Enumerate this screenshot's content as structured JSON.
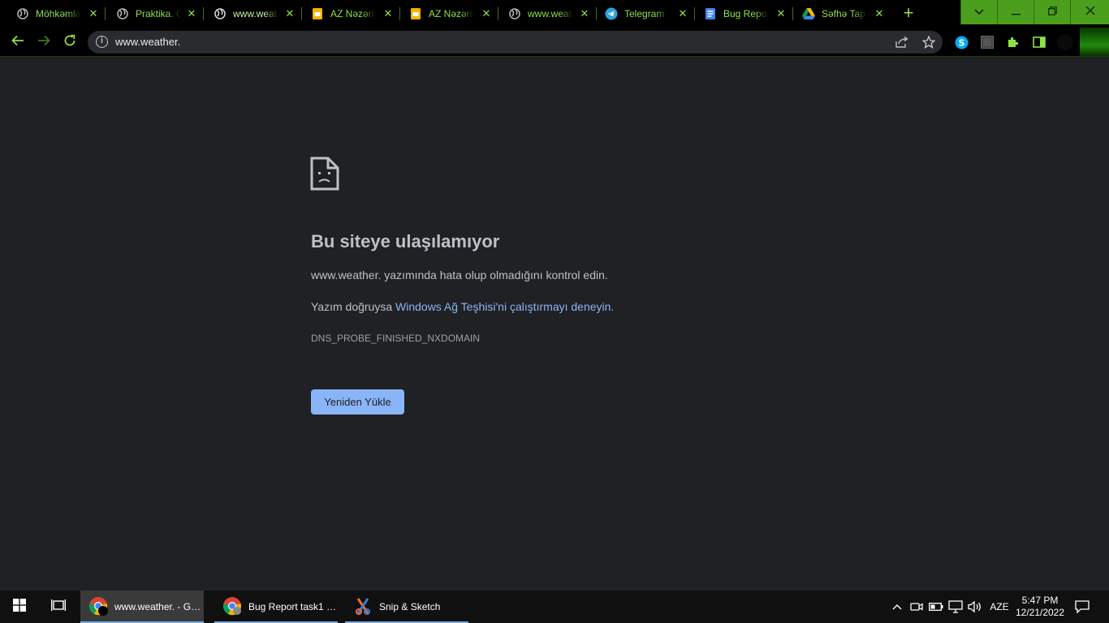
{
  "tabs": [
    {
      "title": "Möhkəmlə",
      "icon": "globe-icon"
    },
    {
      "title": "Praktika. C",
      "icon": "globe-icon"
    },
    {
      "title": "www.weat",
      "icon": "globe-icon",
      "active": true
    },
    {
      "title": "AZ Nəzəriy",
      "icon": "slides-icon"
    },
    {
      "title": "AZ Nəzəriy",
      "icon": "slides-icon"
    },
    {
      "title": "www.weat",
      "icon": "globe-icon"
    },
    {
      "title": "Telegram",
      "icon": "telegram-icon"
    },
    {
      "title": "Bug Repor",
      "icon": "docs-icon"
    },
    {
      "title": "Səfhə Tapı",
      "icon": "drive-icon"
    }
  ],
  "omnibox": {
    "url": "www.weather."
  },
  "error_page": {
    "heading": "Bu siteye ulaşılamıyor",
    "line1": "www.weather. yazımında hata olup olmadığını kontrol edin.",
    "line2_prefix": "Yazım doğruysa ",
    "line2_link": "Windows Ağ Teşhisi'ni çalıştırmayı deneyin.",
    "error_code": "DNS_PROBE_FINISHED_NXDOMAIN",
    "reload_button": "Yeniden Yükle"
  },
  "taskbar": {
    "apps": [
      {
        "label": "www.weather. - Go...",
        "icon": "chrome-icon",
        "active": true
      },
      {
        "label": "Bug Report task1 - ...",
        "icon": "chrome-icon"
      },
      {
        "label": "Snip & Sketch",
        "icon": "snip-sketch-icon"
      }
    ],
    "language": "AZE",
    "time": "5:47 PM",
    "date": "12/21/2022"
  },
  "colors": {
    "accent": "#4c9f1d",
    "tab_text": "#8ee04a",
    "link": "#8ab4f8",
    "page_bg": "#202124"
  }
}
